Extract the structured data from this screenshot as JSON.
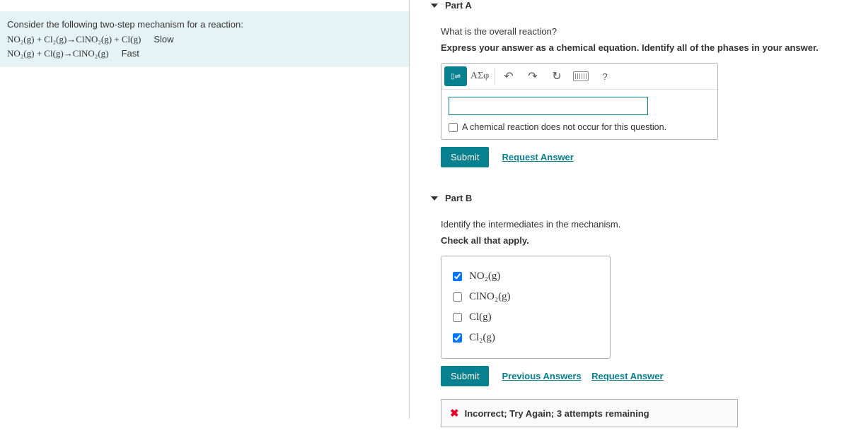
{
  "problem": {
    "intro": "Consider the following two-step mechanism for a reaction:",
    "step1": "NO₂(g) + Cl₂(g)→ClNO₂(g) + Cl(g)",
    "step1_rate": "Slow",
    "step2": "NO₂(g) + Cl(g)→ClNO₂(g)",
    "step2_rate": "Fast"
  },
  "partA": {
    "header": "Part A",
    "q1": "What is the overall reaction?",
    "q2": "Express your answer as a chemical equation. Identify all of the phases in your answer.",
    "toolbar": {
      "template": "▭→",
      "greek": "ΑΣφ",
      "undo": "↶",
      "redo": "↷",
      "reset": "↻",
      "help": "?"
    },
    "no_reaction": "A chemical reaction does not occur for this question.",
    "submit": "Submit",
    "request_answer": "Request Answer"
  },
  "partB": {
    "header": "Part B",
    "q1": "Identify the intermediates in the mechanism.",
    "q2": "Check all that apply.",
    "options": [
      {
        "label": "NO₂(g)",
        "checked": true
      },
      {
        "label": "ClNO₂(g)",
        "checked": false
      },
      {
        "label": "Cl(g)",
        "checked": false
      },
      {
        "label": "Cl₂(g)",
        "checked": true
      }
    ],
    "submit": "Submit",
    "previous_answers": "Previous Answers",
    "request_answer": "Request Answer",
    "feedback": "Incorrect; Try Again; 3 attempts remaining"
  }
}
